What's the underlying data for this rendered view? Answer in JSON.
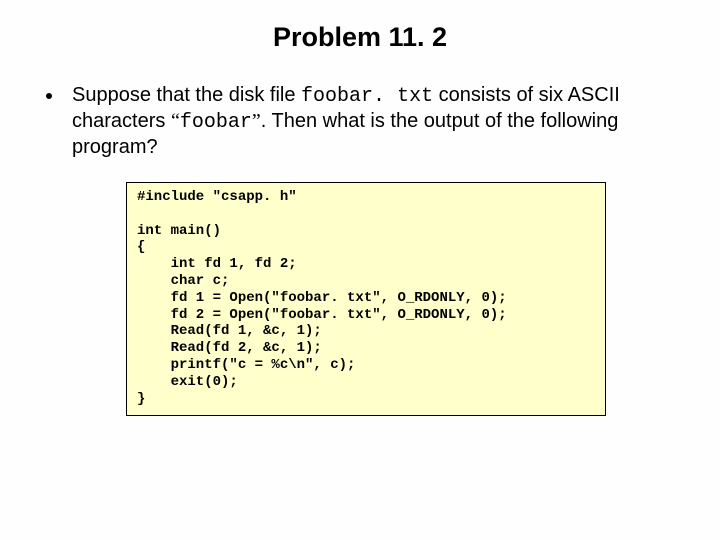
{
  "title": "Problem 11. 2",
  "bullet": {
    "parts": [
      {
        "kind": "plain",
        "text": "Suppose that the disk file "
      },
      {
        "kind": "mono",
        "text": "foobar. txt"
      },
      {
        "kind": "plain",
        "text": " consists of six ASCII characters "
      },
      {
        "kind": "quote",
        "text": "“"
      },
      {
        "kind": "mono",
        "text": "foobar"
      },
      {
        "kind": "quote",
        "text": "”"
      },
      {
        "kind": "plain",
        "text": ".  Then what is the output of the following program?"
      }
    ]
  },
  "code_lines": [
    "#include \"csapp. h\"",
    "",
    "int main()",
    "{",
    "    int fd 1, fd 2;",
    "    char c;",
    "    fd 1 = Open(\"foobar. txt\", O_RDONLY, 0);",
    "    fd 2 = Open(\"foobar. txt\", O_RDONLY, 0);",
    "    Read(fd 1, &c, 1);",
    "    Read(fd 2, &c, 1);",
    "    printf(\"c = %c\\n\", c);",
    "    exit(0);",
    "}"
  ]
}
